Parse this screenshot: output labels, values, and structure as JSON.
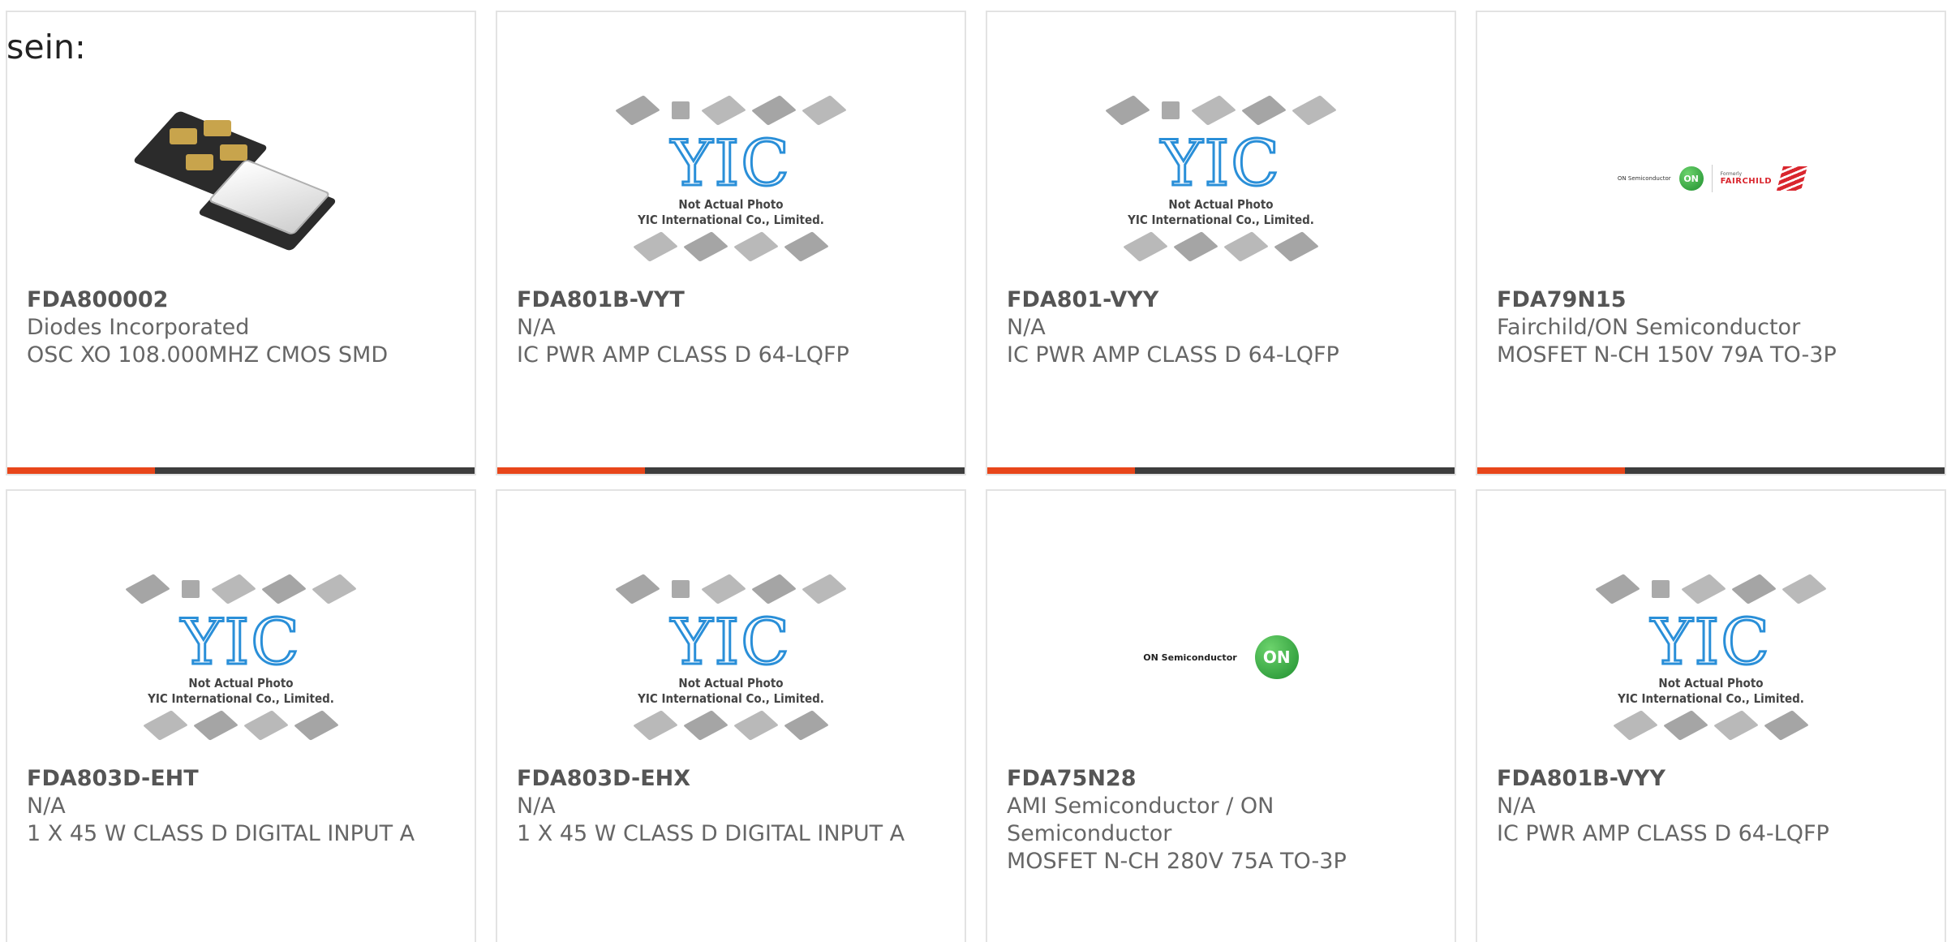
{
  "intro": "sein:",
  "placeholder": {
    "line1": "Not Actual Photo",
    "line2": "YIC International Co., Limited.",
    "logo": "YIC"
  },
  "logos": {
    "on_semiconductor": "ON Semiconductor",
    "on": "ON",
    "formerly": "Formerly",
    "fairchild": "FAIRCHILD"
  },
  "colors": {
    "accent": "#e8461a",
    "bar": "#3d3d3d",
    "yic_blue": "#2a8fd8"
  },
  "products": [
    {
      "part": "FDA800002",
      "mfr": "Diodes Incorporated",
      "desc": "OSC XO 108.000MHZ CMOS SMD",
      "image": "oscillator-photo"
    },
    {
      "part": "FDA801B-VYT",
      "mfr": "N/A",
      "desc": "IC PWR AMP CLASS D 64-LQFP",
      "image": "yic-placeholder"
    },
    {
      "part": "FDA801-VYY",
      "mfr": "N/A",
      "desc": "IC PWR AMP CLASS D 64-LQFP",
      "image": "yic-placeholder"
    },
    {
      "part": "FDA79N15",
      "mfr": "Fairchild/ON Semiconductor",
      "desc": "MOSFET N-CH 150V 79A TO-3P",
      "image": "fairchild-on-logo"
    },
    {
      "part": "FDA803D-EHT",
      "mfr": "N/A",
      "desc": "1 X 45 W CLASS D DIGITAL INPUT A",
      "image": "yic-placeholder"
    },
    {
      "part": "FDA803D-EHX",
      "mfr": "N/A",
      "desc": "1 X 45 W CLASS D DIGITAL INPUT A",
      "image": "yic-placeholder"
    },
    {
      "part": "FDA75N28",
      "mfr": "AMI Semiconductor / ON Semiconductor",
      "desc": "MOSFET N-CH 280V 75A TO-3P",
      "image": "on-semi-logo"
    },
    {
      "part": "FDA801B-VYY",
      "mfr": "N/A",
      "desc": "IC PWR AMP CLASS D 64-LQFP",
      "image": "yic-placeholder"
    }
  ]
}
